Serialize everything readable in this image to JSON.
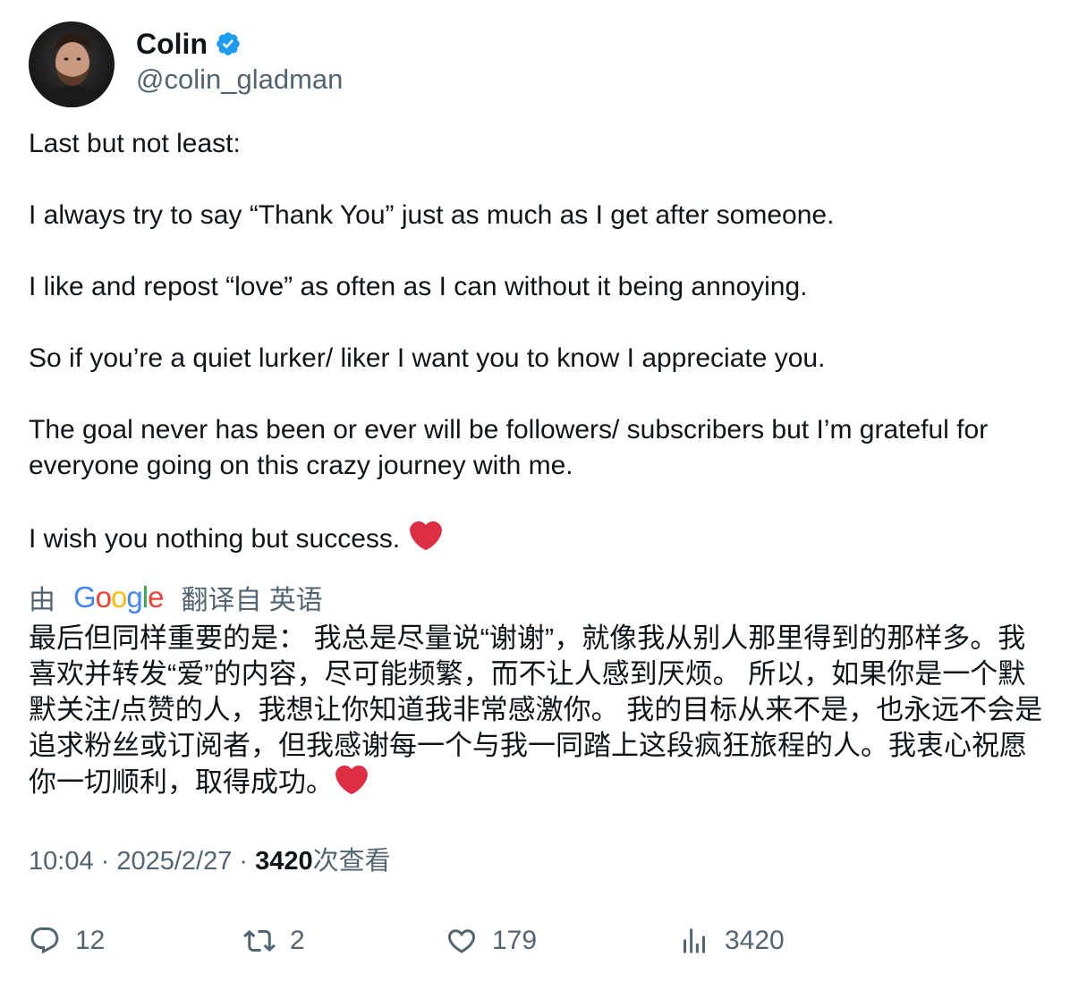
{
  "author": {
    "display_name": "Colin",
    "handle": "@colin_gladman",
    "verified": true,
    "avatar_icon": "profile-photo"
  },
  "tweet": {
    "paragraphs": [
      "Last but not least:",
      "I always try to say “Thank You” just as much as I get after someone.",
      "I like and repost “love” as often as I can without it being annoying.",
      "So if you’re a quiet lurker/ liker I want you to know I appreciate you.",
      "The goal never has been or ever will be followers/ subscribers but I’m grateful for everyone going on this crazy journey with me.",
      "I wish you nothing but success."
    ],
    "emoji": "heart-emoji"
  },
  "translation": {
    "prefix": "由",
    "provider": "Google",
    "suffix": "翻译自 英语",
    "text": "最后但同样重要的是： 我总是尽量说“谢谢”，就像我从别人那里得到的那样多。我喜欢并转发“爱”的内容，尽可能频繁，而不让人感到厌烦。 所以，如果你是一个默默关注/点赞的人，我想让你知道我非常感激你。 我的目标从来不是，也永远不会是追求粉丝或订阅者，但我感谢每一个与我一同踏上这段疯狂旅程的人。我衷心祝愿你一切顺利，取得成功。"
  },
  "meta": {
    "time": "10:04",
    "separator": " · ",
    "date": "2025/2/27",
    "views_count": "3420",
    "views_label": "次查看"
  },
  "actions": {
    "replies": "12",
    "reposts": "2",
    "likes": "179",
    "views": "3420"
  },
  "colors": {
    "text": "#0f1419",
    "secondary": "#536471",
    "verified": "#1d9bf0",
    "heart": "#e0245e"
  }
}
